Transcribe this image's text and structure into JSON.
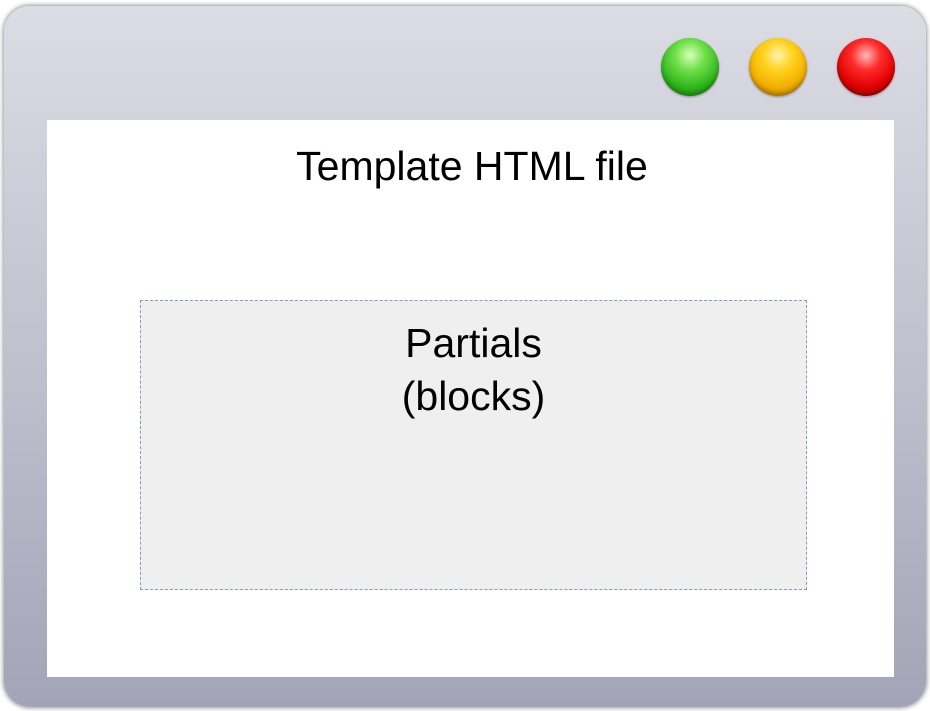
{
  "window": {
    "buttons": [
      {
        "name": "green",
        "color": "#2fb51a"
      },
      {
        "name": "yellow",
        "color": "#f2ae00"
      },
      {
        "name": "red",
        "color": "#de0000"
      }
    ]
  },
  "diagram": {
    "title": "Template HTML file",
    "partials": {
      "line1": "Partials",
      "line2": "(blocks)"
    }
  }
}
